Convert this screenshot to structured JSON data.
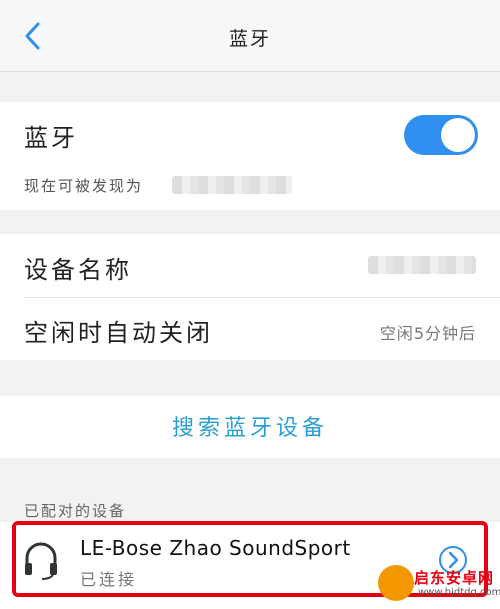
{
  "header": {
    "title": "蓝牙",
    "back_icon": "chevron-left-icon"
  },
  "bluetooth": {
    "label": "蓝牙",
    "enabled": true,
    "discoverable_label": "现在可被发现为",
    "toggle_color": "#2e8ff0"
  },
  "settings": {
    "device_name_label": "设备名称",
    "auto_off_label": "空闲时自动关闭",
    "auto_off_value": "空闲5分钟后"
  },
  "search": {
    "label": "搜索蓝牙设备",
    "color": "#2a9fd6"
  },
  "paired": {
    "section_label": "已配对的设备",
    "devices": [
      {
        "name": "LE-Bose Zhao SoundSport",
        "status": "已连接",
        "icon": "headset-icon"
      }
    ]
  },
  "watermark": {
    "text": "启东安卓网",
    "url": "www.hjdtdq.com"
  },
  "highlight_color": "#e60012"
}
